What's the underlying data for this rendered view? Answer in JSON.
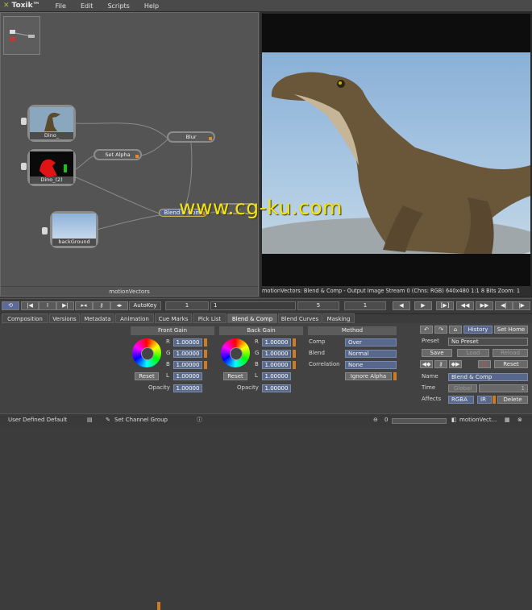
{
  "menubar": {
    "app_title": "Toxik™",
    "items": [
      "File",
      "Edit",
      "Scripts",
      "Help"
    ]
  },
  "node_view": {
    "footer": "motionVectors",
    "nodes": {
      "dino": "Dino_",
      "dino2": "Dino_(2)",
      "background": "backGround"
    },
    "ops": {
      "set_alpha": "Set Alpha",
      "blur": "Blur",
      "blend": "Blend & Comp",
      "overlap": "..."
    }
  },
  "viewer": {
    "status": "motionVectors: Blend & Comp - Output Image  Stream 0 (Chns: RGB)  640x480  1:1  8 Bits  Zoom: 1"
  },
  "watermark": "www.cg-ku.com",
  "toolbar": {
    "autokey": "AutoKey",
    "frame_start": "1",
    "timeline_frame": "1",
    "current_frame": "5",
    "frame_end": "1"
  },
  "tabs": [
    "Composition",
    "Versions",
    "Metadata",
    "Animation",
    "Cue Marks",
    "Pick List",
    "Blend & Comp",
    "Blend Curves",
    "Masking"
  ],
  "front_gain": {
    "title": "Front Gain",
    "r": "1.00000",
    "g": "1.00000",
    "b": "1.00000",
    "l": "1.00000",
    "reset": "Reset",
    "opacity_label": "Opacity",
    "opacity": "1.00000"
  },
  "back_gain": {
    "title": "Back Gain",
    "r": "1.00000",
    "g": "1.00000",
    "b": "1.00000",
    "l": "1.00000",
    "reset": "Reset",
    "opacity_label": "Opacity",
    "opacity": "1.00000"
  },
  "channel_labels": {
    "r": "R",
    "g": "G",
    "b": "B",
    "l": "L"
  },
  "method": {
    "title": "Method",
    "comp_label": "Comp",
    "comp": "Over",
    "blend_label": "Blend",
    "blend": "Normal",
    "correlation_label": "Correlation",
    "correlation": "None",
    "ignore_alpha": "Ignore Alpha"
  },
  "right_panel": {
    "history": "History",
    "set_home": "Set Home",
    "preset_label": "Preset",
    "preset": "No Preset",
    "save": "Save",
    "load": "Load",
    "reload": "Reload",
    "reset": "Reset",
    "name_label": "Name",
    "name": "Blend & Comp",
    "time_label": "Time",
    "time_mode": "Global",
    "time_value": "1",
    "affects_label": "Affects",
    "affects": "RGBA",
    "ir": "IR",
    "delete": "Delete"
  },
  "statusbar": {
    "left": "User Defined Default",
    "channel_group": "Set Channel Group",
    "progress": "0",
    "right": "motionVect..."
  }
}
